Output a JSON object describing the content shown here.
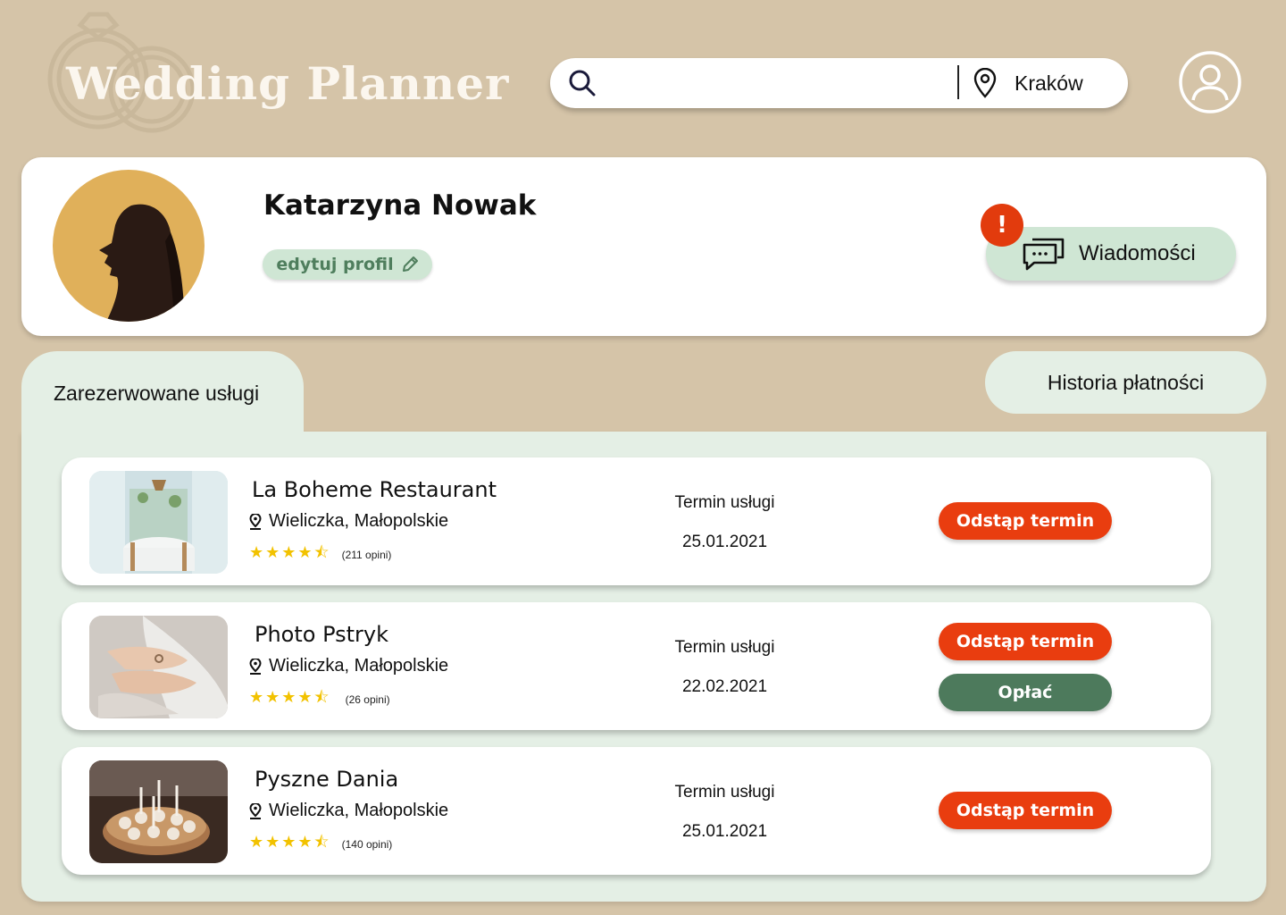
{
  "header": {
    "logo_text": "Wedding Planner",
    "search_placeholder": "",
    "location": "Kraków"
  },
  "profile": {
    "name": "Katarzyna Nowak",
    "edit_label": "edytuj profil",
    "messages_label": "Wiadomości",
    "messages_badge": "!"
  },
  "tabs": [
    {
      "label": "Zarezerwowane usługi",
      "active": true
    },
    {
      "label": "Historia płatności",
      "active": false
    }
  ],
  "services": [
    {
      "name": "La Boheme Restaurant",
      "location": "Wieliczka, Małopolskie",
      "rating": 4.5,
      "reviews": "(211 opini)",
      "date_label": "Termin usługi",
      "date": "25.01.2021",
      "actions": [
        "Odstąp termin"
      ]
    },
    {
      "name": "Photo Pstryk",
      "location": "Wieliczka, Małopolskie",
      "rating": 4.5,
      "reviews": "(26 opini)",
      "date_label": "Termin usługi",
      "date": "22.02.2021",
      "actions": [
        "Odstąp termin",
        "Opłać"
      ]
    },
    {
      "name": "Pyszne Dania",
      "location": "Wieliczka, Małopolskie",
      "rating": 4.5,
      "reviews": "(140 opini)",
      "date_label": "Termin usługi",
      "date": "25.01.2021",
      "actions": [
        "Odstąp termin"
      ]
    }
  ],
  "colors": {
    "background": "#d5c4a8",
    "accent_green": "#cfe6d4",
    "panel_green": "#e4efe5",
    "cancel_red": "#e93d0f",
    "pay_green": "#4d7a5c",
    "star_yellow": "#f2c200"
  },
  "icons": {
    "search": "search-icon",
    "location": "map-pin-icon",
    "user": "user-avatar-icon",
    "edit": "pencil-icon",
    "messages": "chat-bubbles-icon"
  }
}
